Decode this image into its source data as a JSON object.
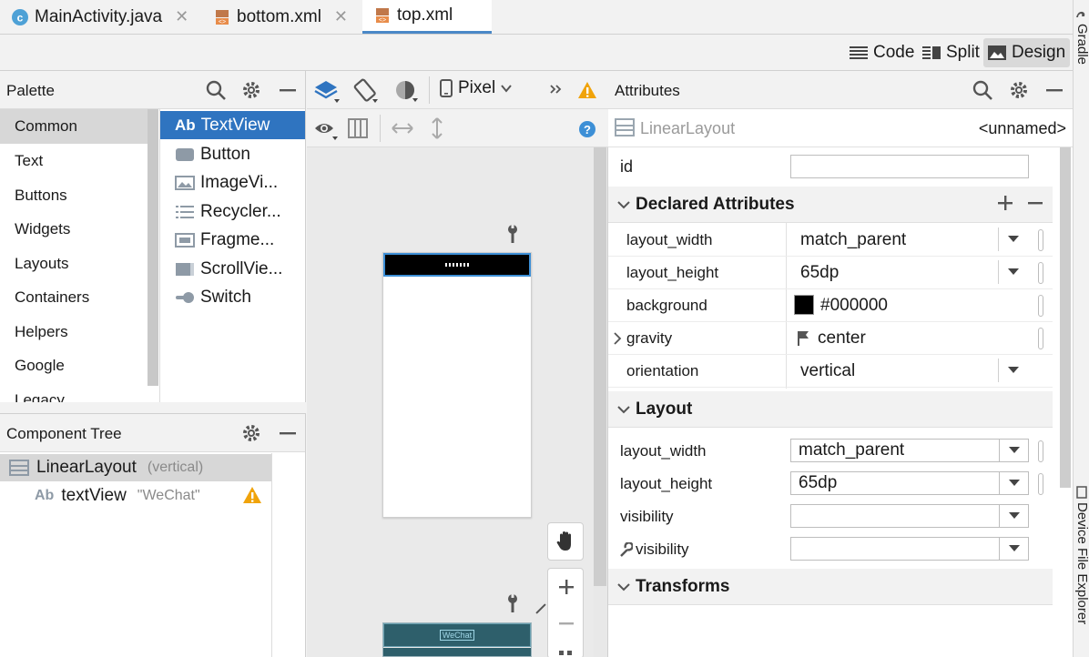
{
  "tabs": [
    {
      "label": "MainActivity.java",
      "icon": "class-c-icon",
      "active": false
    },
    {
      "label": "bottom.xml",
      "icon": "layout-xml-icon",
      "active": false
    },
    {
      "label": "top.xml",
      "icon": "layout-xml-icon",
      "active": true
    }
  ],
  "tab_close_glyph": "✕",
  "right_gutter": {
    "top_label": "Gradle",
    "bottom_label": "Device File Explorer"
  },
  "view_modes": {
    "code": "Code",
    "split": "Split",
    "design": "Design",
    "active": "Design"
  },
  "palette": {
    "title": "Palette",
    "categories": [
      "Common",
      "Text",
      "Buttons",
      "Widgets",
      "Layouts",
      "Containers",
      "Helpers",
      "Google",
      "Legacy"
    ],
    "selected_category": "Common",
    "widgets": [
      {
        "label": "TextView",
        "prefix": "Ab",
        "icon": "textview-icon",
        "selected": true
      },
      {
        "label": "Button",
        "icon": "button-icon"
      },
      {
        "label": "ImageVi...",
        "icon": "imageview-icon"
      },
      {
        "label": "Recycler...",
        "icon": "recyclerview-icon"
      },
      {
        "label": "Fragme...",
        "icon": "fragment-icon"
      },
      {
        "label": "ScrollVie...",
        "icon": "scrollview-icon"
      },
      {
        "label": "Switch",
        "icon": "switch-icon"
      }
    ]
  },
  "component_tree": {
    "title": "Component Tree",
    "nodes": [
      {
        "label": "LinearLayout",
        "detail": "(vertical)",
        "icon": "linearlayout-icon",
        "selected": true
      },
      {
        "label": "textView",
        "prefix": "Ab",
        "detail": "\"WeChat\"",
        "icon": "textview-icon",
        "warning": true
      }
    ]
  },
  "surface": {
    "device": "Pixel",
    "top_bar_color": "#000000",
    "preview_bar_color": "#2e5f6b",
    "preview_label": "WeChat"
  },
  "attributes": {
    "title": "Attributes",
    "component_type": "LinearLayout",
    "component_name": "<unnamed>",
    "id_label": "id",
    "id_value": "",
    "declared": {
      "title": "Declared Attributes",
      "rows": [
        {
          "name": "layout_width",
          "value": "match_parent",
          "has_dropdown": true
        },
        {
          "name": "layout_height",
          "value": "65dp",
          "has_dropdown": true
        },
        {
          "name": "background",
          "value": "#000000",
          "swatch": "#000000"
        },
        {
          "name": "gravity",
          "value": "center",
          "expandable": true,
          "icon": "flag-icon"
        },
        {
          "name": "orientation",
          "value": "vertical",
          "has_dropdown": true
        }
      ]
    },
    "layout": {
      "title": "Layout",
      "rows": [
        {
          "name": "layout_width",
          "value": "match_parent"
        },
        {
          "name": "layout_height",
          "value": "65dp"
        },
        {
          "name": "visibility",
          "value": ""
        },
        {
          "name": "visibility",
          "value": "",
          "icon": "wrench-icon"
        }
      ]
    },
    "transforms": {
      "title": "Transforms"
    }
  },
  "colors": {
    "accent": "#2f74c0",
    "warning": "#f0a30a",
    "help": "#3d8fd6"
  }
}
